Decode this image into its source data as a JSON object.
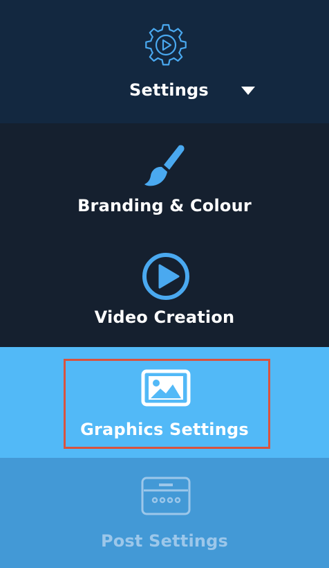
{
  "menu": {
    "settings": {
      "label": "Settings",
      "icon": "gear-play-icon",
      "dropdown_icon": "caret-down-icon"
    },
    "items": [
      {
        "label": "Branding & Colour",
        "icon": "paintbrush-icon"
      },
      {
        "label": "Video Creation",
        "icon": "play-circle-icon"
      },
      {
        "label": "Graphics Settings",
        "icon": "image-icon",
        "state": "active"
      },
      {
        "label": "Post Settings",
        "icon": "post-panel-icon",
        "state": "inactive"
      }
    ]
  },
  "colors": {
    "header_bg": "#132840",
    "menu_bg": "#15202f",
    "active_bg": "#52b9f7",
    "post_bg": "#4399d6",
    "accent_blue": "#4aa9f0",
    "highlight_border": "#d9533e",
    "post_label": "#9cc7ea"
  }
}
